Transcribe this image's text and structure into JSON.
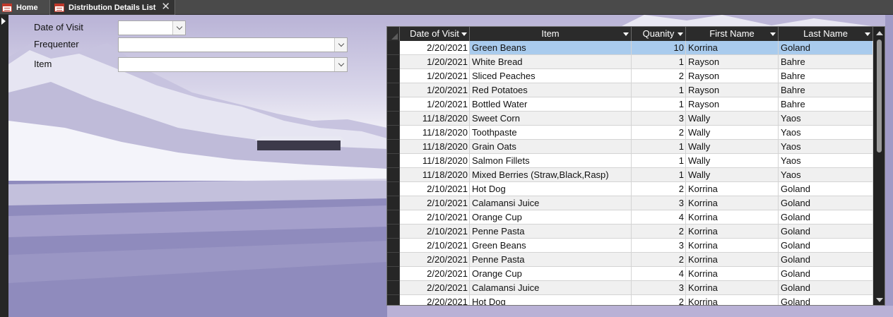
{
  "tabs": {
    "home": {
      "label": "Home",
      "icon": "form-icon"
    },
    "active": {
      "label": "Distribution Details List",
      "icon": "form-icon",
      "close": "✕"
    }
  },
  "filters": {
    "date_of_visit": {
      "label": "Date of Visit",
      "value": ""
    },
    "frequenter": {
      "label": "Frequenter",
      "value": ""
    },
    "item": {
      "label": "Item",
      "value": ""
    }
  },
  "datasheet": {
    "columns": [
      "Date of Visit",
      "Item",
      "Quanity",
      "First Name",
      "Last Name"
    ],
    "rows": [
      {
        "date": "2/20/2021",
        "item": "Green Beans",
        "qty": "10",
        "first": "Korrina",
        "last": "Goland"
      },
      {
        "date": "1/20/2021",
        "item": "White Bread",
        "qty": "1",
        "first": "Rayson",
        "last": "Bahre"
      },
      {
        "date": "1/20/2021",
        "item": "Sliced Peaches",
        "qty": "2",
        "first": "Rayson",
        "last": "Bahre"
      },
      {
        "date": "1/20/2021",
        "item": "Red Potatoes",
        "qty": "1",
        "first": "Rayson",
        "last": "Bahre"
      },
      {
        "date": "1/20/2021",
        "item": "Bottled Water",
        "qty": "1",
        "first": "Rayson",
        "last": "Bahre"
      },
      {
        "date": "11/18/2020",
        "item": "Sweet Corn",
        "qty": "3",
        "first": "Wally",
        "last": "Yaos"
      },
      {
        "date": "11/18/2020",
        "item": "Toothpaste",
        "qty": "2",
        "first": "Wally",
        "last": "Yaos"
      },
      {
        "date": "11/18/2020",
        "item": "Grain Oats",
        "qty": "1",
        "first": "Wally",
        "last": "Yaos"
      },
      {
        "date": "11/18/2020",
        "item": "Salmon Fillets",
        "qty": "1",
        "first": "Wally",
        "last": "Yaos"
      },
      {
        "date": "11/18/2020",
        "item": "Mixed Berries (Straw,Black,Rasp)",
        "qty": "1",
        "first": "Wally",
        "last": "Yaos"
      },
      {
        "date": "2/10/2021",
        "item": "Hot Dog",
        "qty": "2",
        "first": "Korrina",
        "last": "Goland"
      },
      {
        "date": "2/10/2021",
        "item": "Calamansi Juice",
        "qty": "3",
        "first": "Korrina",
        "last": "Goland"
      },
      {
        "date": "2/10/2021",
        "item": "Orange Cup",
        "qty": "4",
        "first": "Korrina",
        "last": "Goland"
      },
      {
        "date": "2/10/2021",
        "item": "Penne Pasta",
        "qty": "2",
        "first": "Korrina",
        "last": "Goland"
      },
      {
        "date": "2/10/2021",
        "item": "Green Beans",
        "qty": "3",
        "first": "Korrina",
        "last": "Goland"
      },
      {
        "date": "2/20/2021",
        "item": "Penne Pasta",
        "qty": "2",
        "first": "Korrina",
        "last": "Goland"
      },
      {
        "date": "2/20/2021",
        "item": "Orange Cup",
        "qty": "4",
        "first": "Korrina",
        "last": "Goland"
      },
      {
        "date": "2/20/2021",
        "item": "Calamansi Juice",
        "qty": "3",
        "first": "Korrina",
        "last": "Goland"
      },
      {
        "date": "2/20/2021",
        "item": "Hot Dog",
        "qty": "2",
        "first": "Korrina",
        "last": "Goland"
      }
    ],
    "selected_row": 0
  },
  "colors": {
    "selection": "#a9cbed",
    "header_bg": "#2b2b2b",
    "tabbar_bg": "#4a4a4a"
  }
}
